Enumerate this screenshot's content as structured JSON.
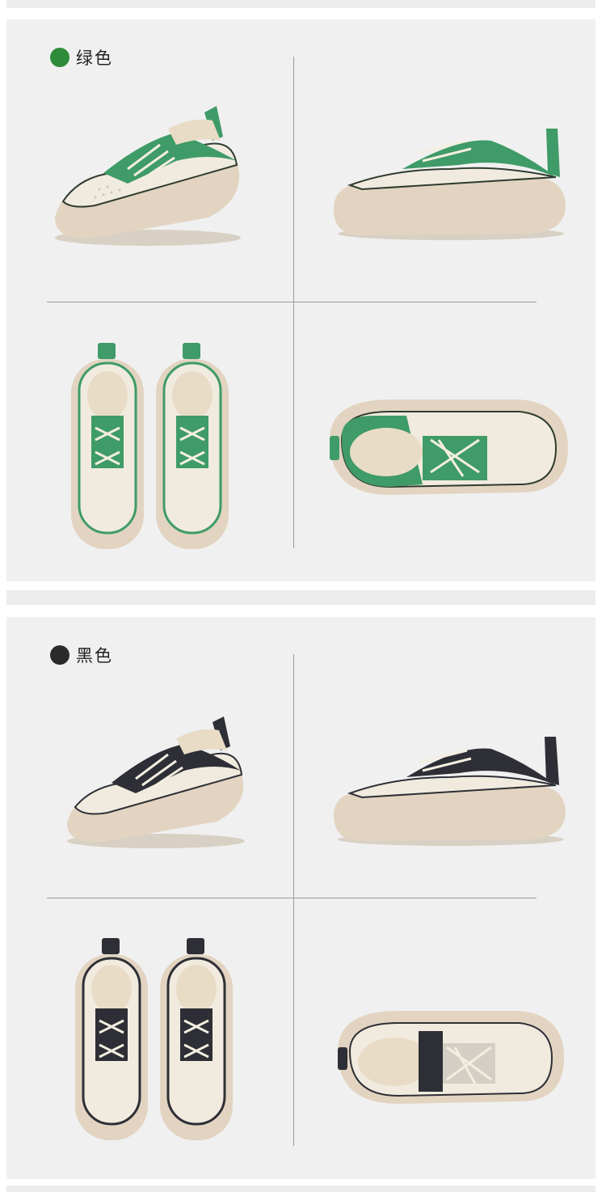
{
  "colors": {
    "green": "#2e8b3a",
    "green_trim": "#3f9b67",
    "black": "#2b2b2b",
    "black_trim": "#2e2f36",
    "sole": "#e2d4c1",
    "upper": "#f1ebdf",
    "lining": "#e9dcc6"
  },
  "sections": [
    {
      "label": "绿色",
      "dot_color": "#2e8b3a"
    },
    {
      "label": "黑色",
      "dot_color": "#2b2b2b"
    }
  ],
  "views": [
    "three-quarter-front",
    "side-profile",
    "top-down-pair",
    "top-angle"
  ]
}
